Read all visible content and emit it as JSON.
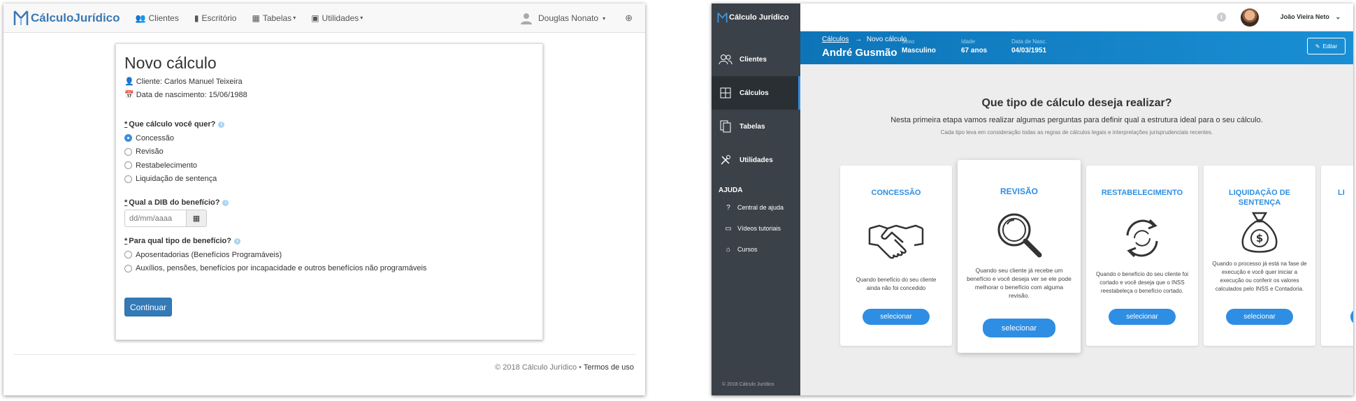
{
  "left": {
    "nav": {
      "brand": "CálculoJurídico",
      "items": [
        {
          "label": "Clientes",
          "icon": "users-icon"
        },
        {
          "label": "Escritório",
          "icon": "building-icon"
        },
        {
          "label": "Tabelas",
          "icon": "table-icon"
        },
        {
          "label": "Utilidades",
          "icon": "calculator-icon"
        }
      ],
      "user": "Douglas Nonato"
    },
    "form": {
      "title": "Novo cálculo",
      "client": "Cliente: Carlos Manuel Teixeira",
      "birth": "Data de nascimento: 15/06/1988",
      "q1": {
        "label": "Que cálculo você quer?",
        "options": [
          "Concessão",
          "Revisão",
          "Restabelecimento",
          "Liquidação de sentença"
        ],
        "selected": "Concessão"
      },
      "q2": {
        "label": "Qual a DIB do benefício?",
        "placeholder": "dd/mm/aaaa"
      },
      "q3": {
        "label": "Para qual tipo de benefício?",
        "options": [
          "Aposentadorias (Benefícios Programáveis)",
          "Auxílios, pensões, benefícios por incapacidade e outros benefícios não programáveis"
        ]
      },
      "required_mark": "*",
      "submit": "Continuar"
    },
    "footer": {
      "copyright": "© 2018 Cálculo Jurídico •",
      "terms": "Termos de uso"
    }
  },
  "right": {
    "sidebar": {
      "brand": "Cálculo Jurídico",
      "items": [
        {
          "label": "Clientes",
          "icon": "users-icon"
        },
        {
          "label": "Cálculos",
          "icon": "calculator-icon",
          "active": true
        },
        {
          "label": "Tabelas",
          "icon": "documents-icon"
        },
        {
          "label": "Utilidades",
          "icon": "tools-icon"
        }
      ],
      "help_title": "AJUDA",
      "help_items": [
        {
          "label": "Central de ajuda",
          "icon": "question-icon"
        },
        {
          "label": "Vídeos tutoriais",
          "icon": "video-icon"
        },
        {
          "label": "Cursos",
          "icon": "graduation-cap-icon"
        }
      ],
      "footer": "© 2018 Cálculo Jurídico"
    },
    "topbar": {
      "user": "João Vieira Neto"
    },
    "banner": {
      "breadcrumb_link": "Cálculos",
      "breadcrumb_current": "Novo cálculo",
      "name": "André Gusmão",
      "fields": [
        {
          "key": "Sexo",
          "value": "Masculino"
        },
        {
          "key": "Idade",
          "value": "67 anos"
        },
        {
          "key": "Data de Nasc.",
          "value": "04/03/1951"
        }
      ],
      "edit": "Editar"
    },
    "main": {
      "title": "Que tipo de cálculo deseja realizar?",
      "subtitle": "Nesta primeira etapa vamos realizar algumas perguntas para definir qual a estrutura ideal para o seu cálculo.",
      "note": "Cada tipo leva em consideração todas as regras de cálculos legais e interpretações jurisprudenciais recentes.",
      "cards": [
        {
          "title": "CONCESSÃO",
          "icon": "handshake-icon",
          "desc": "Quando benefício do seu cliente ainda não foi concedido",
          "button": "selecionar"
        },
        {
          "title": "REVISÃO",
          "icon": "magnifier-icon",
          "desc": "Quando seu cliente já recebe um benefício e você deseja ver se ele pode melhorar o benefício com alguma revisão.",
          "button": "selecionar"
        },
        {
          "title": "RESTABELECIMENTO",
          "icon": "refresh-icon",
          "desc": "Quando o benefício do seu cliente foi cortado e você deseja que o INSS reestabeleça o benefício cortado.",
          "button": "selecionar"
        },
        {
          "title": "LIQUIDAÇÃO DE SENTENÇA",
          "icon": "money-bag-icon",
          "desc": "Quando o processo já está na fase de execução e você quer iniciar a execução ou conferir os valores calculados pelo INSS e Contadoria.",
          "button": "selecionar"
        },
        {
          "title": "LI",
          "icon": "partial-card",
          "desc": "",
          "button": ""
        }
      ]
    }
  }
}
